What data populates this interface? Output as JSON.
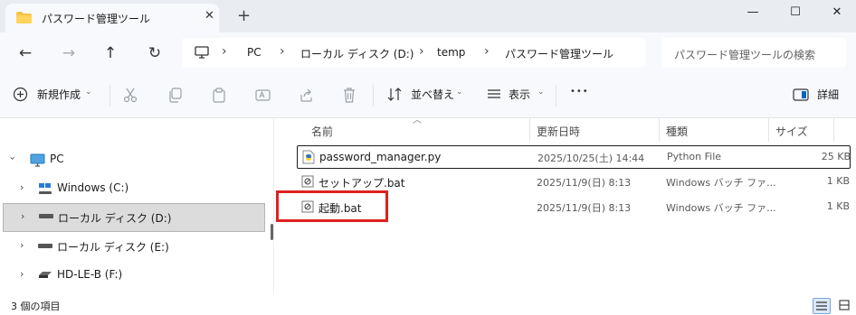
{
  "window": {
    "tab_title": "パスワード管理ツール",
    "tab_close": "✕",
    "new_tab": "+",
    "minimize": "—",
    "maximize": "☐",
    "close": "✕"
  },
  "nav": {
    "back": "←",
    "forward": "→",
    "up": "↑",
    "refresh": "↻"
  },
  "breadcrumb": [
    "PC",
    "ローカル ディスク (D:)",
    "temp",
    "パスワード管理ツール"
  ],
  "breadcrumb_sep": "›",
  "search": {
    "placeholder": "パスワード管理ツールの検索"
  },
  "commands": {
    "new_label": "新規作成",
    "sort_label": "並べ替え",
    "view_label": "表示",
    "more": "•••",
    "details_label": "詳細"
  },
  "tree": [
    {
      "label": "PC",
      "icon": "monitor-icon"
    },
    {
      "label": "Windows (C:)",
      "icon": "windows-drive-icon"
    },
    {
      "label": "ローカル ディスク (D:)",
      "icon": "drive-icon"
    },
    {
      "label": "ローカル ディスク (E:)",
      "icon": "drive-icon"
    },
    {
      "label": "HD-LE-B (F:)",
      "icon": "external-drive-icon"
    }
  ],
  "columns": {
    "name": "名前",
    "date": "更新日時",
    "type": "種類",
    "size": "サイズ"
  },
  "files": [
    {
      "name": "password_manager.py",
      "date": "2025/10/25(土) 14:44",
      "type": "Python File",
      "size": "25 KB"
    },
    {
      "name": "セットアップ.bat",
      "date": "2025/11/9(日) 8:13",
      "type": "Windows バッチ ファ...",
      "size": "1 KB"
    },
    {
      "name": "起動.bat",
      "date": "2025/11/9(日) 8:13",
      "type": "Windows バッチ ファ...",
      "size": "1 KB"
    }
  ],
  "status": {
    "item_count": "3 個の項目"
  },
  "colors": {
    "highlight": "#e02020",
    "selected": "#dcdcdc",
    "accent": "#0067c0"
  }
}
